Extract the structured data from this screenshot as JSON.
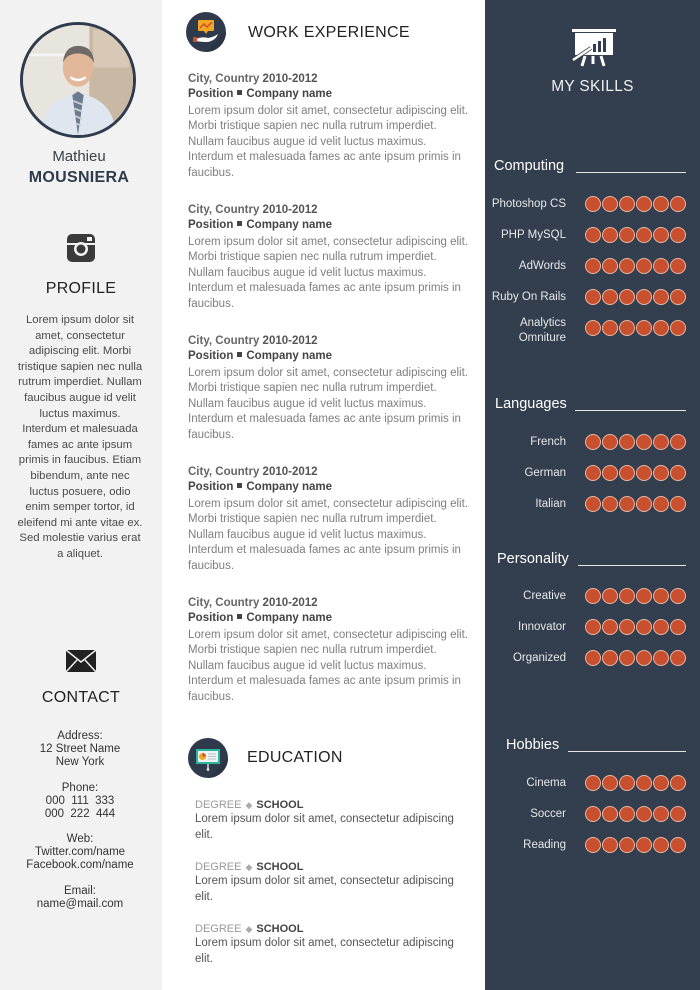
{
  "profile_person": {
    "first_name": "Mathieu",
    "last_name": "MOUSNIERA"
  },
  "profile": {
    "icon": "instagram-icon",
    "title": "PROFILE",
    "text": "Lorem ipsum dolor sit amet, consectetur adipiscing elit.  Morbi tristique sapien nec nulla rutrum imperdiet. Nullam faucibus augue id velit luctus maximus. Interdum et malesuada fames ac ante ipsum primis in faucibus. Etiam bibendum, ante nec luctus posuere, odio enim semper tortor, id eleifend mi ante vitae ex. Sed molestie varius erat a aliquet."
  },
  "contact": {
    "icon": "envelope-icon",
    "title": "CONTACT",
    "address_label": "Address:",
    "address_line1": "12 Street Name",
    "address_line2": "New York",
    "phone_label": "Phone:",
    "phone1": "000  111  333",
    "phone2": "000  222  444",
    "web_label": "Web:",
    "web1": "Twitter.com/name",
    "web2": "Facebook.com/name",
    "email_label": "Email:",
    "email": "name@mail.com"
  },
  "work": {
    "icon": "hand-chart-icon",
    "title": "WORK EXPERIENCE",
    "jobs": [
      {
        "city": "City, Country ",
        "years": "2010-2012",
        "position": "Position",
        "company": "Company name",
        "desc": "Lorem ipsum dolor sit amet, consectetur adipiscing elit. Morbi tristique sapien nec nulla rutrum imperdiet. Nullam faucibus augue id velit luctus maximus. Interdum et malesuada fames ac ante ipsum primis in faucibus."
      },
      {
        "city": "City, Country ",
        "years": "2010-2012",
        "position": "Position",
        "company": "Company name",
        "desc": "Lorem ipsum dolor sit amet, consectetur adipiscing elit. Morbi tristique sapien nec nulla rutrum imperdiet. Nullam faucibus augue id velit luctus maximus. Interdum et malesuada fames ac ante ipsum primis in faucibus."
      },
      {
        "city": "City, Country ",
        "years": "2010-2012",
        "position": "Position",
        "company": "Company name",
        "desc": "Lorem ipsum dolor sit amet, consectetur adipiscing elit. Morbi tristique sapien nec nulla rutrum imperdiet. Nullam faucibus augue id velit luctus maximus. Interdum et malesuada fames ac ante ipsum primis in faucibus."
      },
      {
        "city": "City, Country ",
        "years": "2010-2012",
        "position": "Position",
        "company": "Company name",
        "desc": "Lorem ipsum dolor sit amet, consectetur adipiscing elit. Morbi tristique sapien nec nulla rutrum imperdiet. Nullam faucibus augue id velit luctus maximus. Interdum et malesuada fames ac ante ipsum primis in faucibus."
      },
      {
        "city": "City, Country ",
        "years": "2010-2012",
        "position": "Position",
        "company": "Company name",
        "desc": "Lorem ipsum dolor sit amet, consectetur adipiscing elit. Morbi tristique sapien nec nulla rutrum imperdiet. Nullam faucibus augue id velit luctus maximus. Interdum et malesuada fames ac ante ipsum primis in faucibus."
      }
    ]
  },
  "education": {
    "icon": "presentation-board-icon",
    "title": "EDUCATION",
    "entries": [
      {
        "degree": "DEGREE",
        "school": "SCHOOL",
        "desc": "Lorem ipsum dolor sit amet, consectetur adipiscing elit."
      },
      {
        "degree": "DEGREE",
        "school": "SCHOOL",
        "desc": "Lorem ipsum dolor sit amet, consectetur adipiscing elit."
      },
      {
        "degree": "DEGREE",
        "school": "SCHOOL",
        "desc": "Lorem ipsum dolor sit amet, consectetur adipiscing elit."
      }
    ]
  },
  "skills": {
    "icon": "presentation-chart-icon",
    "title": "MY SKILLS",
    "max_level": 6,
    "groups": [
      {
        "title": "Computing",
        "items": [
          {
            "label": "Photoshop CS",
            "level": 6
          },
          {
            "label": "PHP MySQL",
            "level": 6
          },
          {
            "label": "AdWords",
            "level": 6
          },
          {
            "label": "Ruby On Rails",
            "level": 6
          },
          {
            "label": "Analytics\nOmniture",
            "level": 6
          }
        ]
      },
      {
        "title": "Languages",
        "items": [
          {
            "label": "French",
            "level": 6
          },
          {
            "label": "German",
            "level": 6
          },
          {
            "label": "Italian",
            "level": 6
          }
        ]
      },
      {
        "title": "Personality",
        "items": [
          {
            "label": "Creative",
            "level": 6
          },
          {
            "label": "Innovator",
            "level": 6
          },
          {
            "label": "Organized",
            "level": 6
          }
        ]
      },
      {
        "title": "Hobbies",
        "items": [
          {
            "label": "Cinema",
            "level": 6
          },
          {
            "label": "Soccer",
            "level": 6
          },
          {
            "label": "Reading",
            "level": 6
          }
        ]
      }
    ]
  },
  "colors": {
    "sidebar_bg": "#f2f2f2",
    "navy": "#333e4e",
    "accent_orange": "#c8502e"
  }
}
